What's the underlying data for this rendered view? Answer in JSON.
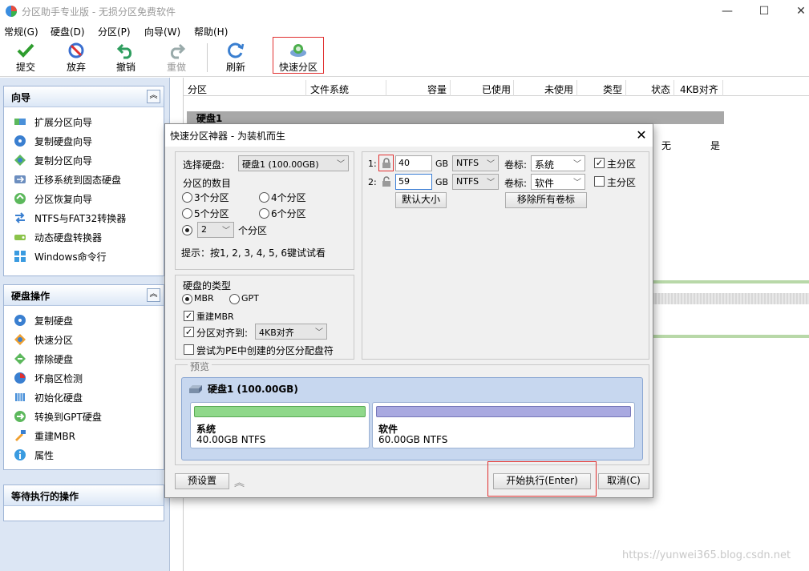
{
  "window": {
    "title": "分区助手专业版 - 无损分区免费软件",
    "controls": {
      "minimize": "—",
      "maximize": "☐",
      "close": "✕"
    }
  },
  "menu": [
    "常规(G)",
    "硬盘(D)",
    "分区(P)",
    "向导(W)",
    "帮助(H)"
  ],
  "toolbar": [
    {
      "label": "提交",
      "icon": "check-icon",
      "enabled": true
    },
    {
      "label": "放弃",
      "icon": "discard-icon",
      "enabled": true
    },
    {
      "label": "撤销",
      "icon": "undo-icon",
      "enabled": true
    },
    {
      "label": "重做",
      "icon": "redo-icon",
      "enabled": false
    },
    {
      "label": "刷新",
      "icon": "refresh-icon",
      "enabled": true
    },
    {
      "label": "快速分区",
      "icon": "quick-partition-icon",
      "enabled": true
    }
  ],
  "sidebar": {
    "wizard": {
      "title": "向导",
      "items": [
        "扩展分区向导",
        "复制硬盘向导",
        "复制分区向导",
        "迁移系统到固态硬盘",
        "分区恢复向导",
        "NTFS与FAT32转换器",
        "动态硬盘转换器",
        "Windows命令行"
      ]
    },
    "disk_ops": {
      "title": "硬盘操作",
      "items": [
        "复制硬盘",
        "快速分区",
        "擦除硬盘",
        "坏扇区检测",
        "初始化硬盘",
        "转换到GPT硬盘",
        "重建MBR",
        "属性"
      ]
    },
    "pending": {
      "title": "等待执行的操作"
    }
  },
  "table": {
    "columns": [
      "分区",
      "文件系统",
      "容量",
      "已使用",
      "未使用",
      "类型",
      "状态",
      "4KB对齐"
    ],
    "disk_label": "硬盘1",
    "partial_row": {
      "status": "无",
      "aligned": "是"
    }
  },
  "dialog": {
    "title": "快速分区神器 - 为装机而生",
    "select_disk_label": "选择硬盘:",
    "select_disk_value": "硬盘1 (100.00GB)",
    "count_label": "分区的数目",
    "count_options": [
      "3个分区",
      "4个分区",
      "5个分区",
      "6个分区"
    ],
    "custom_count_value": "2",
    "custom_count_suffix": "个分区",
    "hint": "提示：按1, 2, 3, 4, 5, 6键试试看",
    "disk_type_label": "硬盘的类型",
    "disk_type_options": [
      "MBR",
      "GPT"
    ],
    "disk_type_selected": "MBR",
    "rebuild_mbr": "重建MBR",
    "align_label": "分区对齐到:",
    "align_value": "4KB对齐",
    "pe_label": "尝试为PE中创建的分区分配盘符",
    "partitions": [
      {
        "index": "1:",
        "size": "40",
        "unit": "GB",
        "fs": "NTFS",
        "vol_label": "卷标:",
        "name": "系统",
        "primary_label": "主分区",
        "primary": true
      },
      {
        "index": "2:",
        "size": "59",
        "unit": "GB",
        "fs": "NTFS",
        "vol_label": "卷标:",
        "name": "软件",
        "primary_label": "主分区",
        "primary": false
      }
    ],
    "default_size_btn": "默认大小",
    "remove_labels_btn": "移除所有卷标",
    "preview_label": "预览",
    "preview_disk": "硬盘1 (100.00GB)",
    "preview_parts": [
      {
        "name": "系统",
        "size": "40.00GB NTFS",
        "color": "#8fd88a"
      },
      {
        "name": "软件",
        "size": "60.00GB NTFS",
        "color": "#a9a9e0"
      }
    ],
    "preset_btn": "预设置",
    "start_btn": "开始执行(Enter)",
    "cancel_btn": "取消(C)",
    "close": "✕"
  },
  "watermark": "https://yunwei365.blog.csdn.net"
}
